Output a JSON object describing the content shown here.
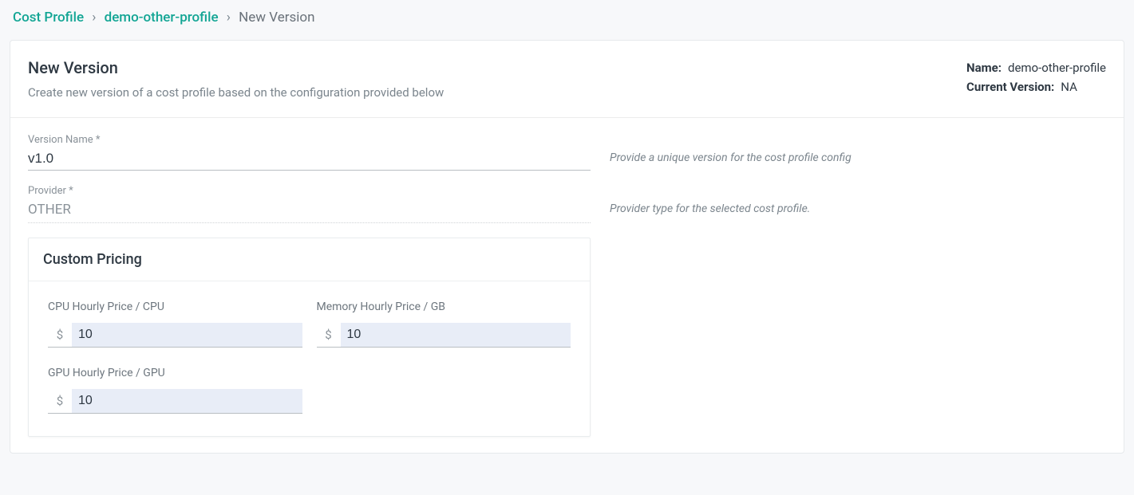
{
  "breadcrumb": {
    "root": "Cost Profile",
    "profile": "demo-other-profile",
    "leaf": "New Version",
    "sep": "›"
  },
  "header": {
    "title": "New Version",
    "subtitle": "Create new version of a cost profile based on the configuration provided below",
    "name_key": "Name:",
    "name_val": "demo-other-profile",
    "curver_key": "Current Version:",
    "curver_val": "NA"
  },
  "fields": {
    "version_name_label": "Version Name *",
    "version_name_value": "v1.0",
    "version_name_help": "Provide a unique version for the cost profile config",
    "provider_label": "Provider *",
    "provider_value": "OTHER",
    "provider_help": "Provider type for the selected cost profile."
  },
  "pricing": {
    "panel_title": "Custom Pricing",
    "currency": "$",
    "cpu_label": "CPU Hourly Price / CPU",
    "cpu_value": "10",
    "mem_label": "Memory Hourly Price / GB",
    "mem_value": "10",
    "gpu_label": "GPU Hourly Price / GPU",
    "gpu_value": "10"
  }
}
